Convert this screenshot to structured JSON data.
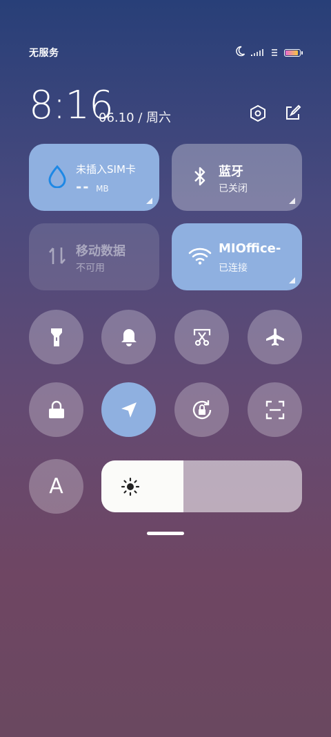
{
  "status_bar": {
    "carrier": "无服务",
    "icons": [
      "moon-icon",
      "signal-icon",
      "data-icon",
      "battery-icon"
    ],
    "battery_level": 0.9
  },
  "header": {
    "time": "8:16",
    "date": "06.10 / 周六",
    "icons": [
      "settings-icon",
      "edit-icon"
    ]
  },
  "tiles": {
    "data_usage": {
      "title": "未插入SIM卡",
      "value": "--",
      "unit": "MB",
      "state": "on"
    },
    "bluetooth": {
      "title": "蓝牙",
      "status": "已关闭",
      "state": "off"
    },
    "mobile_data": {
      "title": "移动数据",
      "status": "不可用",
      "state": "disabled"
    },
    "wifi": {
      "title": "MIOffice-",
      "status": "已连接",
      "state": "on"
    }
  },
  "toggles": [
    {
      "name": "flashlight",
      "icon": "flashlight-icon",
      "active": false
    },
    {
      "name": "ringer",
      "icon": "bell-icon",
      "active": false
    },
    {
      "name": "screenshot",
      "icon": "scissors-icon",
      "active": false
    },
    {
      "name": "airplane-mode",
      "icon": "airplane-icon",
      "active": false
    },
    {
      "name": "lock-screen",
      "icon": "lock-icon",
      "active": false
    },
    {
      "name": "location",
      "icon": "location-arrow-icon",
      "active": true
    },
    {
      "name": "auto-rotate",
      "icon": "rotate-lock-icon",
      "active": false
    },
    {
      "name": "scanner",
      "icon": "scan-icon",
      "active": false
    }
  ],
  "auto_brightness": {
    "label": "A"
  },
  "brightness": {
    "level": 0.41,
    "icon": "sun-icon"
  },
  "colors": {
    "tile_active": "#8fb0e0",
    "battery_gradient_start": "#e86bd0",
    "battery_gradient_end": "#f5c542"
  }
}
